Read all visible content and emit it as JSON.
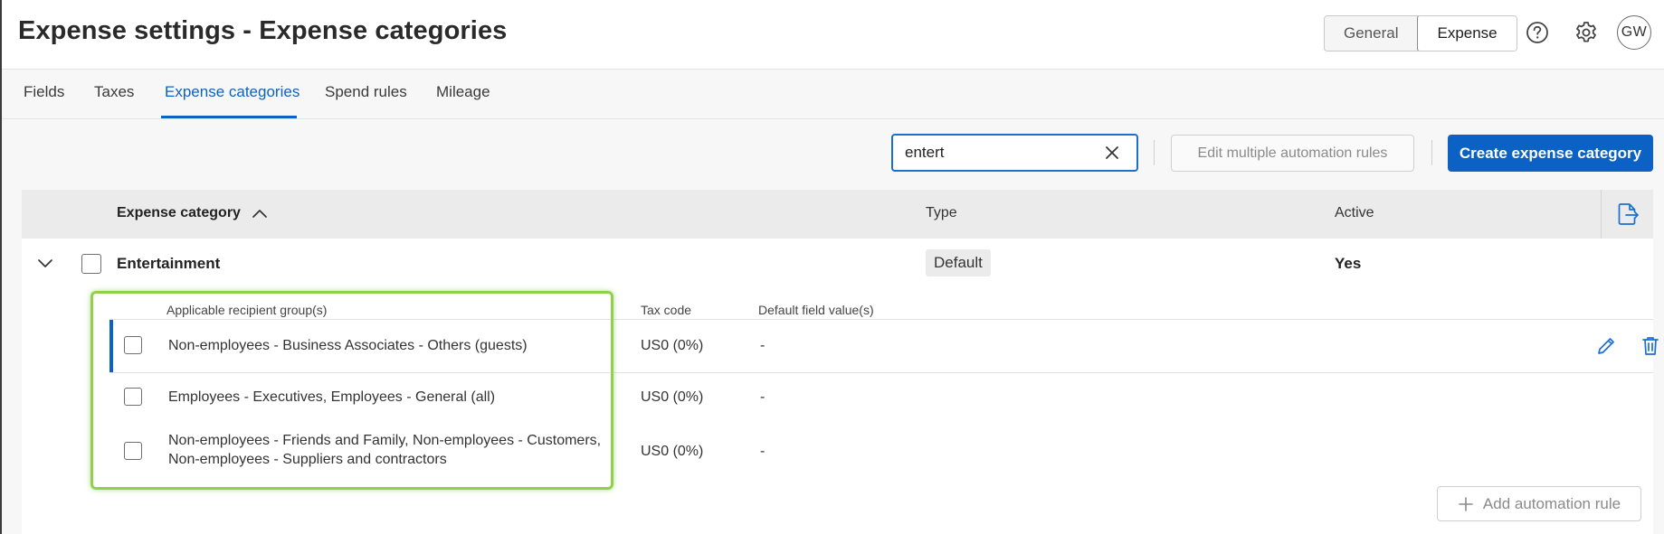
{
  "header": {
    "title": "Expense settings - Expense categories",
    "toggle": {
      "general": "General",
      "expense": "Expense",
      "selected": "Expense"
    },
    "avatar_initials": "GW",
    "icons": [
      "help-icon",
      "gear-icon"
    ]
  },
  "tabs": [
    {
      "label": "Fields"
    },
    {
      "label": "Taxes"
    },
    {
      "label": "Expense categories",
      "active": true
    },
    {
      "label": "Spend rules"
    },
    {
      "label": "Mileage"
    }
  ],
  "toolbar": {
    "search_value": "entert",
    "edit_multiple_label": "Edit multiple automation rules",
    "create_label": "Create expense category"
  },
  "table": {
    "columns": {
      "category": "Expense category",
      "type": "Type",
      "active": "Active"
    },
    "rows": [
      {
        "name": "Entertainment",
        "type": "Default",
        "active": "Yes",
        "expanded": true,
        "sub_columns": {
          "recipients": "Applicable recipient group(s)",
          "tax_code": "Tax code",
          "defaults": "Default field value(s)"
        },
        "rules": [
          {
            "recipients": "Non-employees - Business Associates - Others (guests)",
            "tax_code": "US0 (0%)",
            "defaults": "-"
          },
          {
            "recipients": "Employees - Executives, Employees - General (all)",
            "tax_code": "US0 (0%)",
            "defaults": "-"
          },
          {
            "recipients_line1": "Non-employees - Friends and Family, Non-employees - Customers,",
            "recipients_line2": "Non-employees - Suppliers and contractors",
            "tax_code": "US0 (0%)",
            "defaults": "-"
          }
        ],
        "add_rule_label": "Add automation rule"
      }
    ]
  },
  "colors": {
    "accent": "#0b62c4",
    "highlight": "#8fd14f"
  }
}
